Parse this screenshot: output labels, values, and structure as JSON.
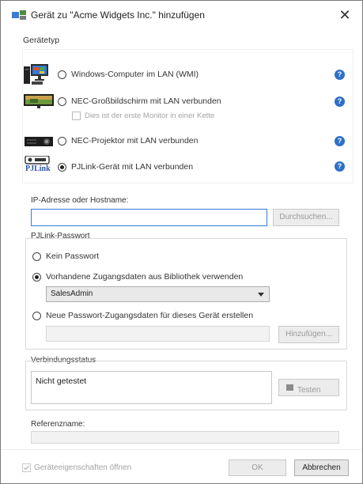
{
  "dialog": {
    "title": "Gerät zu \"Acme Widgets Inc.\" hinzufügen",
    "close_glyph": "✕"
  },
  "device_type": {
    "legend": "Gerätetyp",
    "options": [
      {
        "label": "Windows-Computer im LAN (WMI)",
        "selected": false,
        "icon": "windows-computer-icon"
      },
      {
        "label": "NEC-Großbildschirm mit LAN verbunden",
        "selected": false,
        "icon": "large-display-icon"
      },
      {
        "label": "NEC-Projektor mit LAN verbunden",
        "selected": false,
        "icon": "projector-icon"
      },
      {
        "label": "PJLink-Gerät mit LAN verbunden",
        "selected": true,
        "icon": "pjlink-icon"
      }
    ],
    "first_monitor_label": "Dies ist der erste Monitor in einer Kette",
    "info_glyph": "?",
    "pjlink_icon_text": "PJLink"
  },
  "address": {
    "label": "IP-Adresse oder Hostname:",
    "value": "",
    "browse_button": "Durchsuchen..."
  },
  "password": {
    "legend": "PJLink-Passwort",
    "options": [
      {
        "label": "Kein Passwort",
        "selected": false
      },
      {
        "label": "Vorhandene Zugangsdaten aus Bibliothek verwenden",
        "selected": true
      },
      {
        "label": "Neue Passwort-Zugangsdaten für dieses Gerät erstellen",
        "selected": false
      }
    ],
    "credential_select": "SalesAdmin",
    "add_button": "Hinzufügen..."
  },
  "connection": {
    "legend": "Verbindungsstatus",
    "status": "Nicht getestet",
    "test_button": "Testen"
  },
  "reference": {
    "label": "Referenzname:",
    "value": ""
  },
  "footer": {
    "open_properties_label": "Geräteeigenschaften öffnen",
    "ok_button": "OK",
    "cancel_button": "Abbrechen"
  }
}
